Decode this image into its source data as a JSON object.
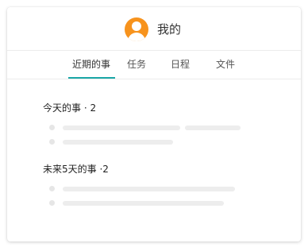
{
  "header": {
    "title": "我的",
    "avatar_icon": "user-avatar-icon",
    "avatar_color": "#f7931d"
  },
  "tabs": [
    {
      "label": "近期的事",
      "active": true
    },
    {
      "label": "任务",
      "active": false
    },
    {
      "label": "日程",
      "active": false
    },
    {
      "label": "文件",
      "active": false
    }
  ],
  "accent_color": "#1aa7a7",
  "sections": [
    {
      "title": "今天的事 · 2",
      "item_count": 2
    },
    {
      "title": "未来5天的事 ·2",
      "item_count": 2
    }
  ]
}
